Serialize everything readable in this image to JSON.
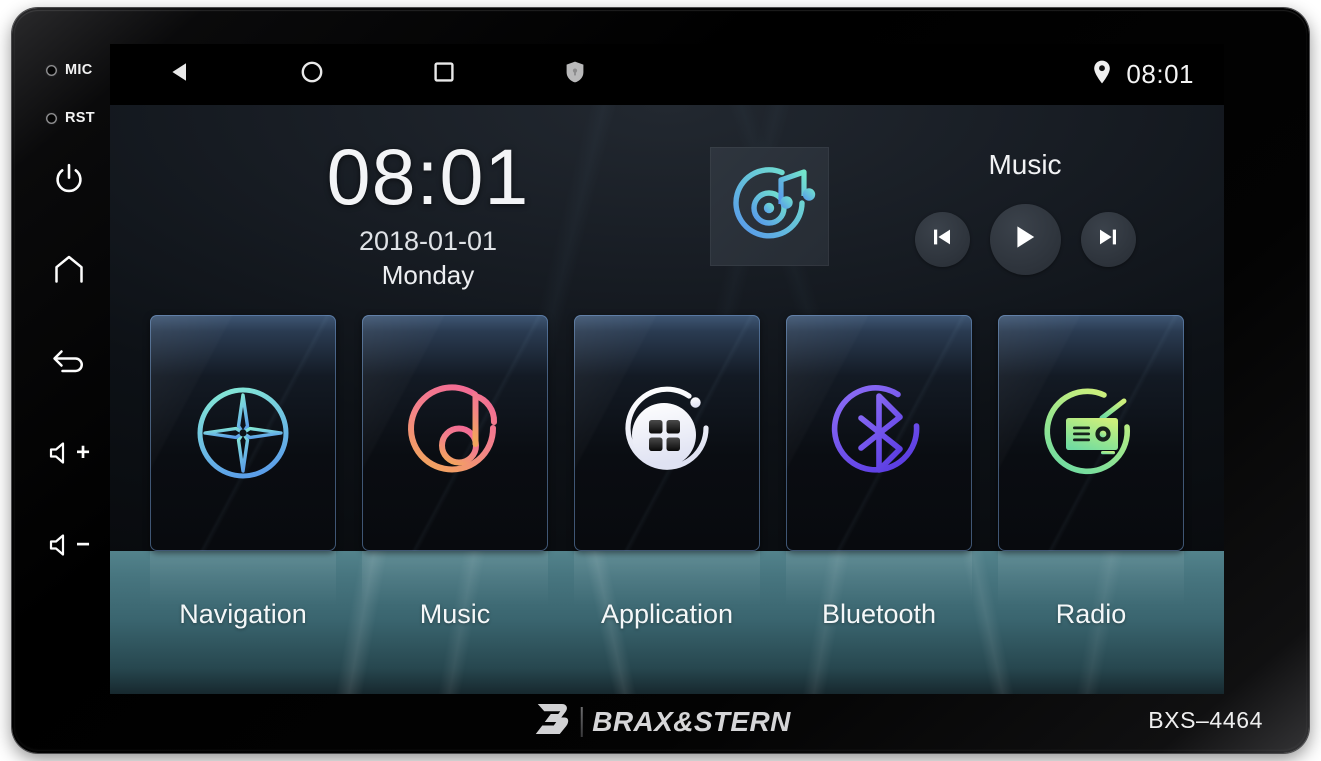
{
  "device": {
    "brand_name": "BRAX&STERN",
    "brand_mark": "b-logo-icon",
    "model_number": "BXS–4464",
    "hardware_keys": [
      {
        "id": "mic",
        "label": "MIC",
        "icon": "mic-hole-icon"
      },
      {
        "id": "rst",
        "label": "RST",
        "icon": "reset-hole-icon"
      },
      {
        "id": "power",
        "label": "",
        "icon": "power-icon"
      },
      {
        "id": "home",
        "label": "",
        "icon": "home-icon"
      },
      {
        "id": "back",
        "label": "",
        "icon": "back-arrow-icon"
      },
      {
        "id": "vol-up",
        "label": "+",
        "icon": "volume-up-icon"
      },
      {
        "id": "vol-down",
        "label": "−",
        "icon": "volume-down-icon"
      }
    ]
  },
  "statusbar": {
    "nav_keys": [
      {
        "name": "back",
        "icon": "triangle-back-icon"
      },
      {
        "name": "home",
        "icon": "circle-home-icon"
      },
      {
        "name": "recents",
        "icon": "square-recents-icon"
      },
      {
        "name": "security",
        "icon": "shield-icon"
      }
    ],
    "location_icon": "location-pin-icon",
    "clock": "08:01"
  },
  "clock_widget": {
    "time": "08:01",
    "date": "2018-01-01",
    "weekday": "Monday"
  },
  "music_widget": {
    "title": "Music",
    "album_art_icon": "disc-music-note-icon",
    "controls": [
      {
        "name": "previous",
        "icon": "skip-previous-icon"
      },
      {
        "name": "play",
        "icon": "play-icon"
      },
      {
        "name": "next",
        "icon": "skip-next-icon"
      }
    ]
  },
  "tiles": [
    {
      "label": "Navigation",
      "icon": "compass-icon",
      "color_from": "#7fe3d4",
      "color_to": "#5a9fe8"
    },
    {
      "label": "Music",
      "icon": "music-note-icon",
      "color_from": "#f4718f",
      "color_to": "#f0a05e"
    },
    {
      "label": "Application",
      "icon": "app-grid-icon",
      "color_from": "#ffffff",
      "color_to": "#d8dbef"
    },
    {
      "label": "Bluetooth",
      "icon": "bluetooth-icon",
      "color_from": "#7d5cf0",
      "color_to": "#5b3fe0"
    },
    {
      "label": "Radio",
      "icon": "radio-icon",
      "color_from": "#c3ee7e",
      "color_to": "#73dc9e"
    }
  ],
  "colors": {
    "bezel": "#000000",
    "screen_bg": "#12161b",
    "statusbar_bg": "#000000",
    "label_strip": "#3a656f",
    "tile_border": "#6e96c8",
    "accent_teal": "#6ee0c8",
    "accent_blue": "#5a9ee8"
  }
}
